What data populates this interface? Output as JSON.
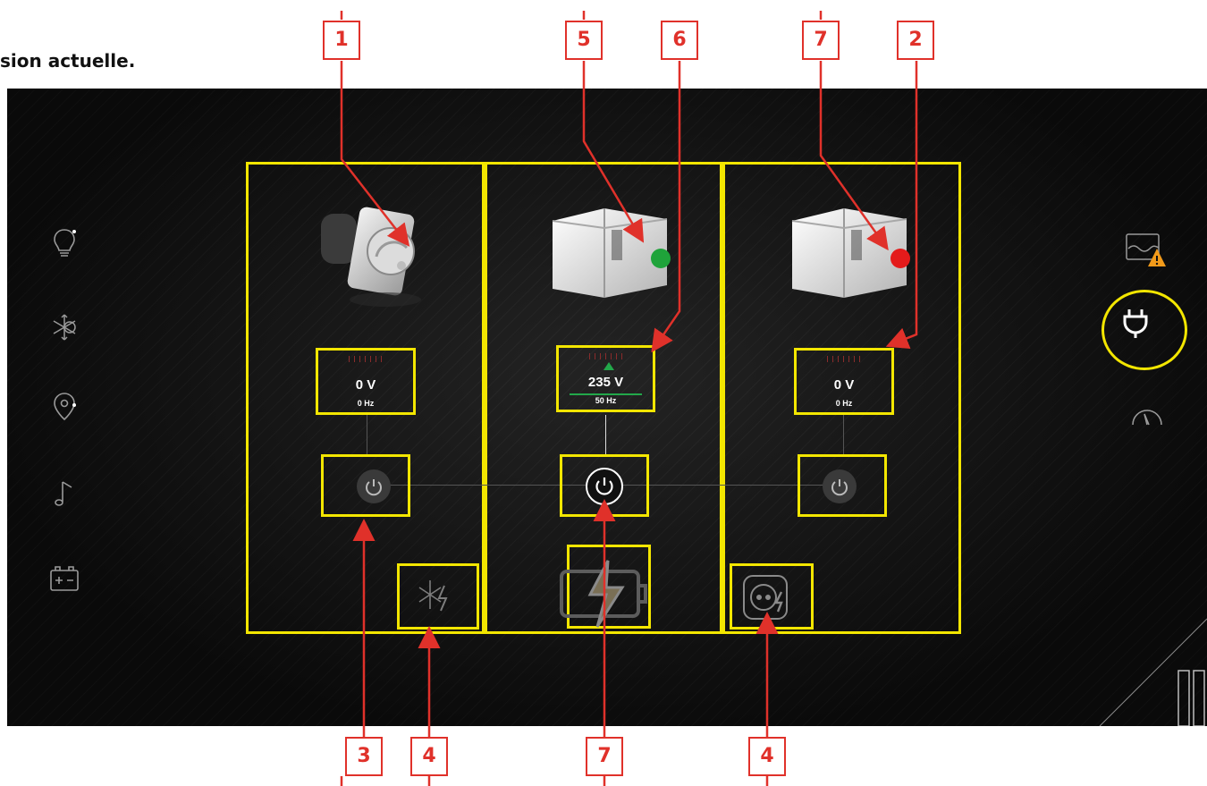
{
  "caption": "sion actuelle.",
  "panels": [
    {
      "voltage": "0 V",
      "frequency": "0 Hz"
    },
    {
      "voltage": "235 V",
      "frequency": "50 Hz"
    },
    {
      "voltage": "0 V",
      "frequency": "0 Hz"
    }
  ],
  "callouts": {
    "top": [
      "1",
      "5",
      "6",
      "7",
      "2"
    ],
    "bottom": [
      "3",
      "4",
      "7",
      "4"
    ]
  },
  "left_nav_icons": [
    "lightbulb-icon",
    "climate-icon",
    "location-icon",
    "music-icon",
    "battery-icon"
  ],
  "right_nav_icons": [
    "water-warning-icon",
    "plug-icon",
    "gauge-icon"
  ],
  "status_colors": {
    "generator_running": "#1fa33a",
    "generator_stopped": "#e41b1b",
    "highlight": "#f3e600",
    "callout": "#e0312a"
  }
}
